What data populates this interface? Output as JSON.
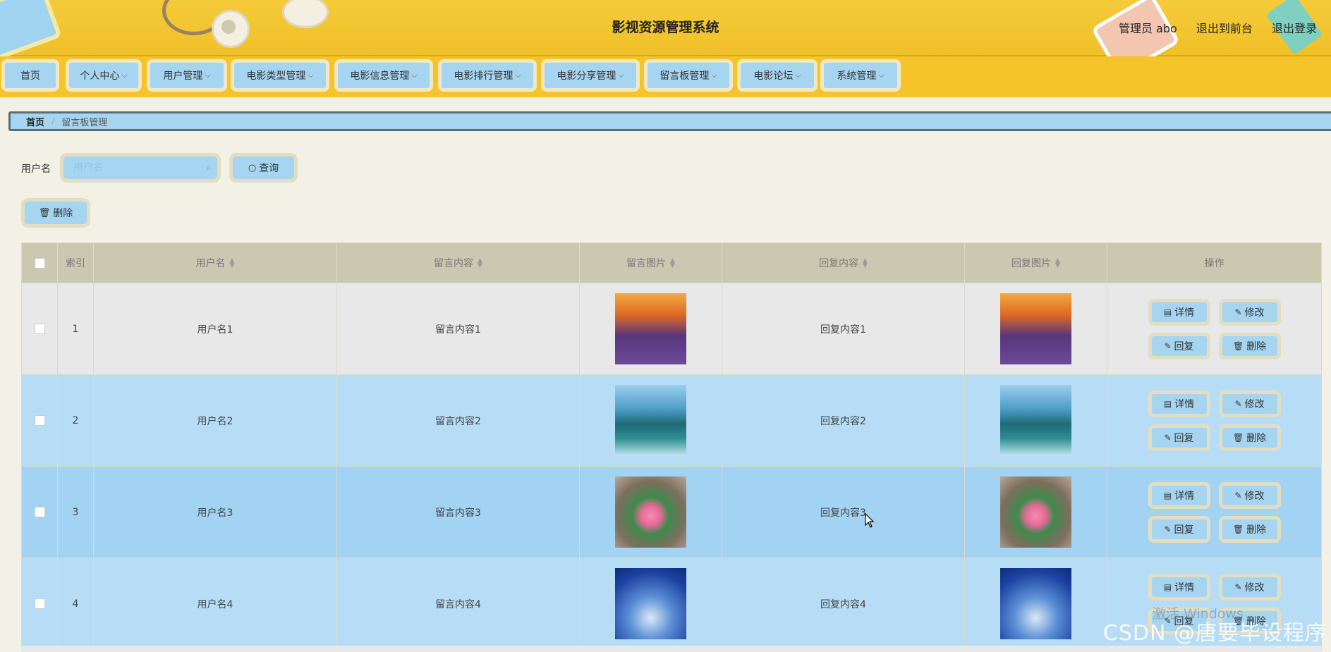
{
  "header": {
    "title": "影视资源管理系统",
    "user_label": "管理员 abo",
    "to_front": "退出到前台",
    "logout": "退出登录"
  },
  "nav": {
    "items": [
      {
        "label": "首页"
      },
      {
        "label": "个人中心"
      },
      {
        "label": "用户管理"
      },
      {
        "label": "电影类型管理"
      },
      {
        "label": "电影信息管理"
      },
      {
        "label": "电影排行管理"
      },
      {
        "label": "电影分享管理"
      },
      {
        "label": "留言板管理"
      },
      {
        "label": "电影论坛"
      },
      {
        "label": "系统管理"
      }
    ]
  },
  "breadcrumb": {
    "home": "首页",
    "separator": "/",
    "current": "留言板管理"
  },
  "search": {
    "label": "用户名",
    "placeholder": "用户名",
    "button": "查询"
  },
  "toolbar": {
    "delete_label": "删除"
  },
  "table": {
    "headers": {
      "index": "索引",
      "username": "用户名",
      "content": "留言内容",
      "image": "留言图片",
      "reply": "回复内容",
      "reply_image": "回复图片",
      "actions": "操作"
    },
    "rows": [
      {
        "index": "1",
        "username": "用户名1",
        "content": "留言内容1",
        "reply": "回复内容1"
      },
      {
        "index": "2",
        "username": "用户名2",
        "content": "留言内容2",
        "reply": "回复内容2"
      },
      {
        "index": "3",
        "username": "用户名3",
        "content": "留言内容3",
        "reply": "回复内容3"
      },
      {
        "index": "4",
        "username": "用户名4",
        "content": "留言内容4",
        "reply": "回复内容4"
      }
    ],
    "actions": {
      "detail": "详情",
      "edit": "修改",
      "reply": "回复",
      "delete": "删除"
    }
  },
  "overlay": {
    "windows_text": "激活 Windows",
    "watermark": "CSDN @唐要毕设程序"
  },
  "colors": {
    "header_yellow": "#f4c42a",
    "button_blue": "#a6d5f2",
    "button_border": "#e3ddc2",
    "header_row": "#cbc8b1"
  }
}
